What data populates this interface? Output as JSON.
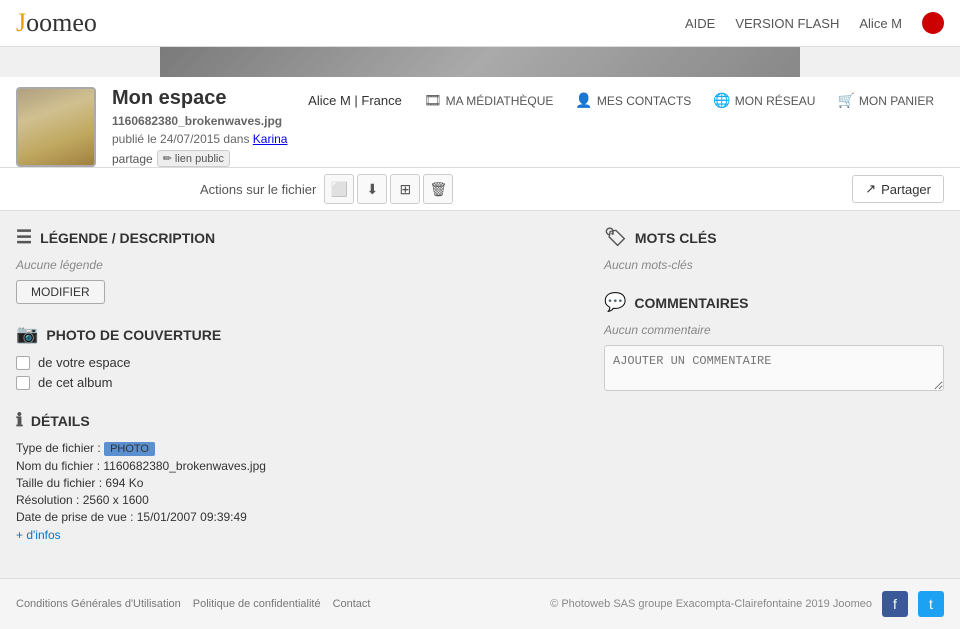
{
  "header": {
    "logo_j": "J",
    "logo_rest": "oomeo",
    "aide": "AIDE",
    "version_flash": "VERSION FLASH",
    "alice": "Alice M",
    "separator": "|"
  },
  "profile": {
    "title": "Mon espace",
    "user_name": "Alice M | France",
    "file_name": "1160682380_brokenwaves.jpg",
    "published": "publié le 24/07/2015 dans",
    "karina": "Karina",
    "partage": "partage",
    "lien_public": "lien public"
  },
  "nav": {
    "ma_mediatheque": "MA MÉDIATHÈQUE",
    "mes_contacts": "MES CONTACTS",
    "mon_reseau": "MON RÉSEAU",
    "mon_panier": "MON PANIER"
  },
  "actions": {
    "label": "Actions sur le fichier",
    "partager_label": "Partager"
  },
  "legende": {
    "title": "LÉGENDE / DESCRIPTION",
    "aucune": "Aucune légende",
    "modifier": "MODIFIER"
  },
  "photo_couverture": {
    "title": "PHOTO DE COUVERTURE",
    "option1": "de votre espace",
    "option2": "de cet album"
  },
  "details": {
    "title": "DÉTAILS",
    "type_label": "Type de fichier :",
    "type_value": "PHOTO",
    "nom_label": "Nom du fichier :",
    "nom_value": "1160682380_brokenwaves.jpg",
    "taille_label": "Taille du fichier :",
    "taille_value": "694 Ko",
    "resolution_label": "Résolution :",
    "resolution_value": "2560 x 1600",
    "date_label": "Date de prise de vue :",
    "date_value": "15/01/2007 09:39:49",
    "plus": "+ d'infos"
  },
  "mots_cles": {
    "title": "MOTS CLÉS",
    "aucun": "Aucun mots-clés"
  },
  "commentaires": {
    "title": "COMMENTAIRES",
    "aucun": "Aucun commentaire",
    "placeholder": "AJOUTER UN COMMENTAIRE"
  },
  "footer": {
    "conditions": "Conditions Générales d'Utilisation",
    "politique": "Politique de confidentialité",
    "contact": "Contact",
    "copy": "© Photoweb SAS groupe Exacompta-Clairefontaine 2019 Joomeo"
  },
  "icons": {
    "list": "☰",
    "image": "🖼",
    "chat": "💬",
    "tag": "🏷",
    "info": "ℹ",
    "photo_cover": "📷",
    "screen": "⬜",
    "download": "⬇",
    "grid": "⊞",
    "trash": "🗑",
    "share": "↗",
    "mediatheque": "🎞",
    "contacts": "👤",
    "reseau": "🌐",
    "panier": "🛒",
    "pencil": "✏",
    "facebook": "f",
    "twitter": "t"
  }
}
